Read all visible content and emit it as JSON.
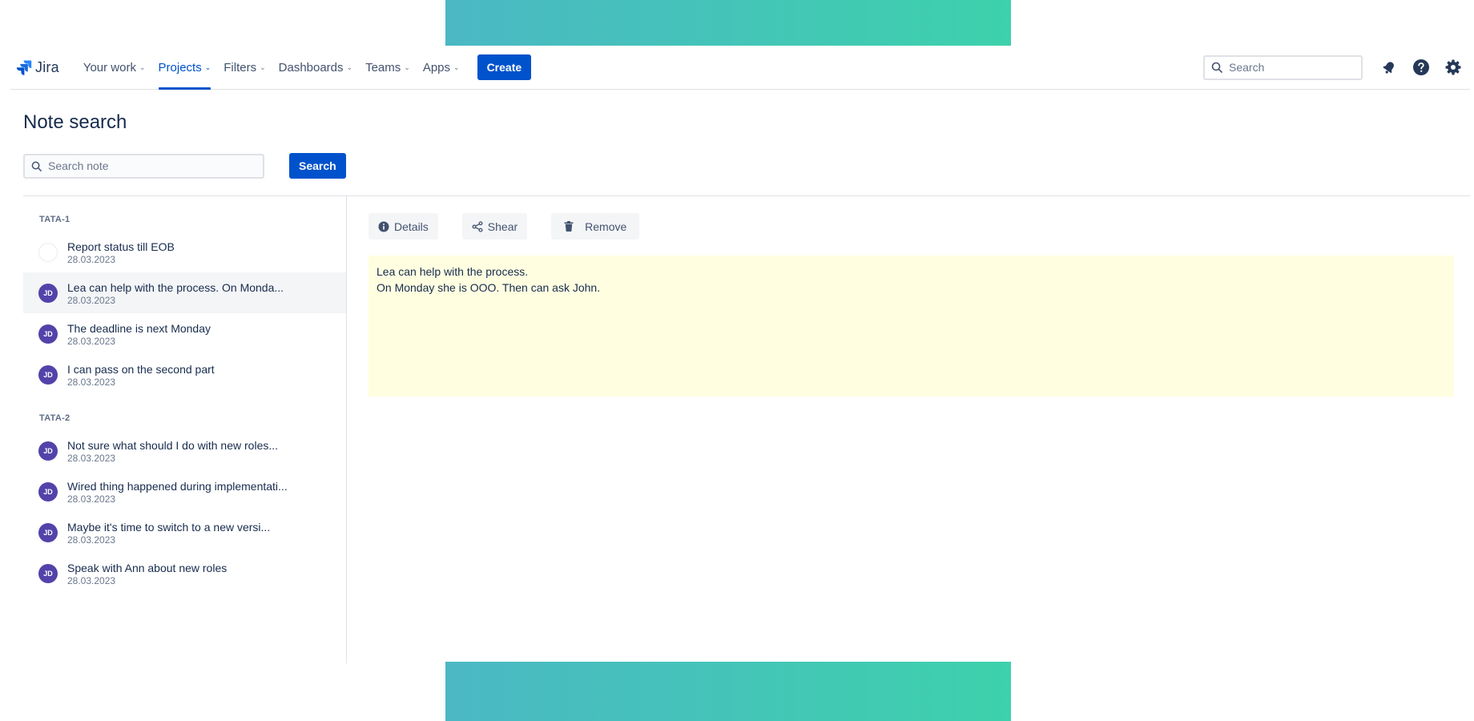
{
  "nav": {
    "logo_text": "Jira",
    "items": [
      {
        "label": "Your work"
      },
      {
        "label": "Projects"
      },
      {
        "label": "Filters"
      },
      {
        "label": "Dashboards"
      },
      {
        "label": "Teams"
      },
      {
        "label": "Apps"
      }
    ],
    "active_item": "Projects",
    "create_label": "Create",
    "search_placeholder": "Search",
    "icons": [
      "notifications-icon",
      "help-icon",
      "settings-icon"
    ]
  },
  "page": {
    "title": "Note search",
    "search_placeholder": "Search note",
    "search_button": "Search"
  },
  "groups": [
    {
      "label": "TATA-1",
      "notes": [
        {
          "avatar": "",
          "title": "Report status till EOB",
          "date": "28.03.2023"
        },
        {
          "avatar": "JD",
          "title": "Lea can help with the process. On Monda...",
          "date": "28.03.2023",
          "selected": true
        },
        {
          "avatar": "JD",
          "title": "The deadline is next Monday",
          "date": "28.03.2023"
        },
        {
          "avatar": "JD",
          "title": "I can pass on the second part",
          "date": "28.03.2023"
        }
      ]
    },
    {
      "label": "TATA-2",
      "notes": [
        {
          "avatar": "JD",
          "title": "Not sure what should I do with new roles...",
          "date": "28.03.2023"
        },
        {
          "avatar": "JD",
          "title": "Wired thing happened during implementati...",
          "date": "28.03.2023"
        },
        {
          "avatar": "JD",
          "title": "Maybe it's time to switch to a new versi...",
          "date": "28.03.2023"
        },
        {
          "avatar": "JD",
          "title": "Speak with Ann about new roles",
          "date": "28.03.2023"
        }
      ]
    }
  ],
  "detail": {
    "actions": {
      "details": "Details",
      "share": "Shear",
      "remove": "Remove"
    },
    "note_lines": [
      "Lea can help with the process.",
      "On Monday she is OOO. Then can ask John."
    ]
  },
  "colors": {
    "primary": "#0052CC",
    "avatar": "#5243AA",
    "note_background": "#FFFEE0",
    "banner_start": "#4bb8c4",
    "banner_end": "#3dd1ac"
  }
}
